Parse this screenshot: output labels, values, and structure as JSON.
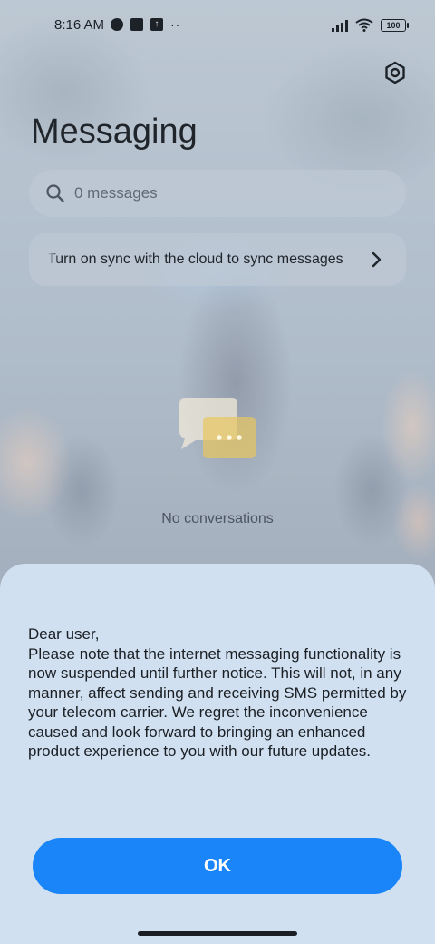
{
  "status_bar": {
    "time": "8:16 AM",
    "battery": "100",
    "more_dots": "··"
  },
  "header": {
    "title": "Messaging",
    "settings_icon": "gear-icon"
  },
  "search": {
    "placeholder": "0 messages"
  },
  "sync_banner": {
    "text": "Turn on sync with the cloud to sync messages"
  },
  "empty_state": {
    "label": "No conversations"
  },
  "dialog": {
    "greeting": "Dear user,",
    "body": "Please note that the internet messaging functionality is now suspended until further notice. This will not, in any manner, affect sending and receiving SMS permitted by your telecom carrier. We regret the inconvenience caused and look forward to bringing an enhanced product experience to you with our future updates.",
    "ok_label": "OK"
  },
  "colors": {
    "accent": "#1a85f8",
    "sheet_bg": "#d0e0f1",
    "empty_icon_back": "#f0e9d8",
    "empty_icon_front": "#e8c660"
  }
}
